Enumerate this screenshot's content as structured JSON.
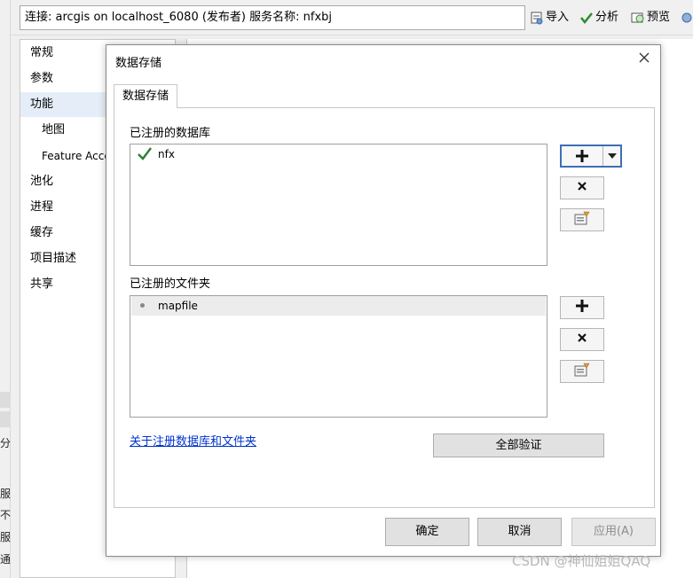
{
  "connection_text": "连接: arcgis on localhost_6080 (发布者)    服务名称: nfxbj",
  "toolbar": {
    "import_label": "导入",
    "analyze_label": "分析",
    "preview_label": "预览"
  },
  "nav": {
    "items": [
      {
        "label": "常规"
      },
      {
        "label": "参数"
      },
      {
        "label": "功能"
      },
      {
        "label": "地图"
      },
      {
        "label": "Feature Access"
      },
      {
        "label": "池化"
      },
      {
        "label": "进程"
      },
      {
        "label": "缓存"
      },
      {
        "label": "项目描述"
      },
      {
        "label": "共享"
      }
    ]
  },
  "left_fragments": [
    "分析",
    "服",
    "不",
    "服",
    "通"
  ],
  "dialog": {
    "title": "数据存储",
    "tab_label": "数据存储",
    "db_section_label": "已注册的数据库",
    "db_items": [
      {
        "name": "nfx"
      }
    ],
    "folder_section_label": "已注册的文件夹",
    "folder_items": [
      {
        "name": "mapfile"
      }
    ],
    "help_link": "关于注册数据库和文件夹",
    "verify_all_label": "全部验证",
    "ok_label": "确定",
    "cancel_label": "取消",
    "apply_label": "应用(A)"
  },
  "watermark": "CSDN @神仙姐姐QAQ"
}
